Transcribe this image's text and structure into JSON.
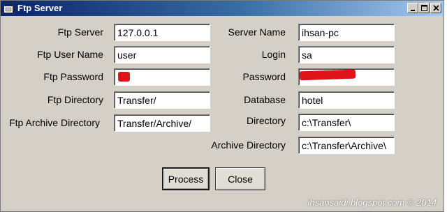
{
  "window": {
    "title": "Ftp Server"
  },
  "form": {
    "ftp_server": {
      "label": "Ftp Server",
      "value": "127.0.0.1"
    },
    "ftp_user_name": {
      "label": "Ftp User Name",
      "value": "user"
    },
    "ftp_password": {
      "label": "Ftp Password",
      "value": ""
    },
    "ftp_directory": {
      "label": "Ftp Directory",
      "value": "Transfer/"
    },
    "ftp_archive_directory": {
      "label": "Ftp Archive Directory",
      "value": "Transfer/Archive/"
    },
    "server_name": {
      "label": "Server Name",
      "value": "ihsan-pc"
    },
    "login": {
      "label": "Login",
      "value": "sa"
    },
    "password": {
      "label": "Password",
      "value": ""
    },
    "database": {
      "label": "Database",
      "value": "hotel"
    },
    "directory": {
      "label": "Directory",
      "value": "c:\\Transfer\\"
    },
    "archive_directory": {
      "label": "Archive Directory",
      "value": "c:\\Transfer\\Archive\\"
    }
  },
  "buttons": {
    "process": "Process",
    "close": "Close"
  },
  "watermark": "ihsansaidi.blogspot.com © 2014",
  "colors": {
    "titlebar_start": "#0a246a",
    "titlebar_end": "#a6caf0",
    "window_bg": "#d4d0c8",
    "redaction": "#e0131a"
  }
}
